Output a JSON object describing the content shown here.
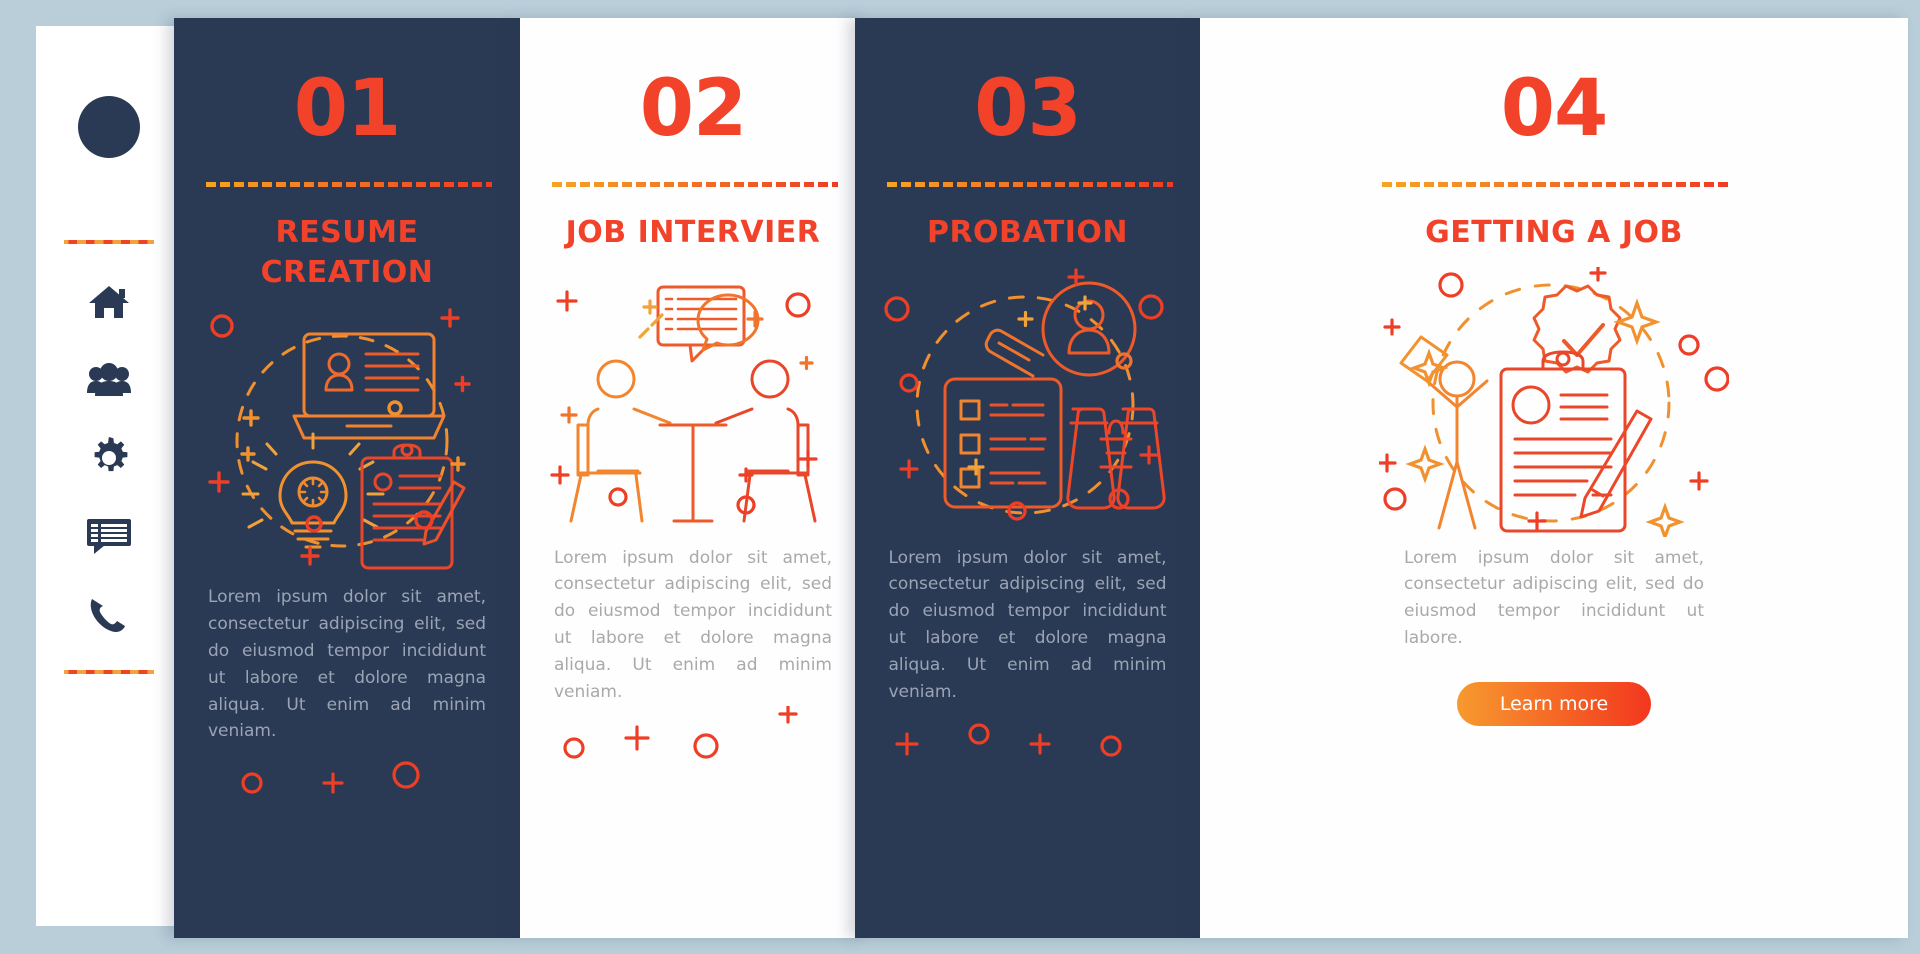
{
  "theme": {
    "page_background": "#b9ced9",
    "card_dark": "#2b3a54",
    "card_light": "#fefefe",
    "accent_red": "#f2422a",
    "accent_orange": "#f5a623",
    "body_text_dark_card": "#9aa4b4",
    "body_text_light_card": "#a9a9a9"
  },
  "sidebar": {
    "logo": "logo-circle",
    "items": [
      {
        "icon": "home-icon",
        "label": "Home"
      },
      {
        "icon": "people-icon",
        "label": "People"
      },
      {
        "icon": "gear-icon",
        "label": "Settings"
      },
      {
        "icon": "chat-icon",
        "label": "Messages"
      },
      {
        "icon": "phone-icon",
        "label": "Contact"
      }
    ]
  },
  "cards": [
    {
      "number": "01",
      "title": "RESUME CREATION",
      "theme": "dark",
      "illustration": "laptop-lightbulb-clipboard-illustration",
      "body": "Lorem ipsum dolor sit amet, consectetur adipiscing elit, sed do eiusmod tempor incididunt ut labore et dolore magna aliqua. Ut enim ad minim veniam.",
      "button": null
    },
    {
      "number": "02",
      "title": "JOB INTERVIER",
      "theme": "light",
      "illustration": "interview-table-illustration",
      "body": "Lorem ipsum dolor sit amet, consectetur adipiscing elit, sed do eiusmod tempor incididunt ut labore et dolore magna aliqua. Ut enim ad minim veniam.",
      "button": null
    },
    {
      "number": "03",
      "title": "PROBATION",
      "theme": "dark",
      "illustration": "magnifier-checklist-binoculars-illustration",
      "body": "Lorem ipsum dolor sit amet, consectetur adipiscing elit, sed do eiusmod tempor incididunt ut labore et dolore magna aliqua. Ut enim ad minim veniam.",
      "button": null
    },
    {
      "number": "04",
      "title": "GETTING A JOB",
      "theme": "light",
      "illustration": "celebration-badge-clipboard-illustration",
      "body": "Lorem ipsum dolor sit amet, consectetur adipiscing elit, sed do eiusmod tempor incididunt ut labore.",
      "button": "Learn more"
    }
  ]
}
